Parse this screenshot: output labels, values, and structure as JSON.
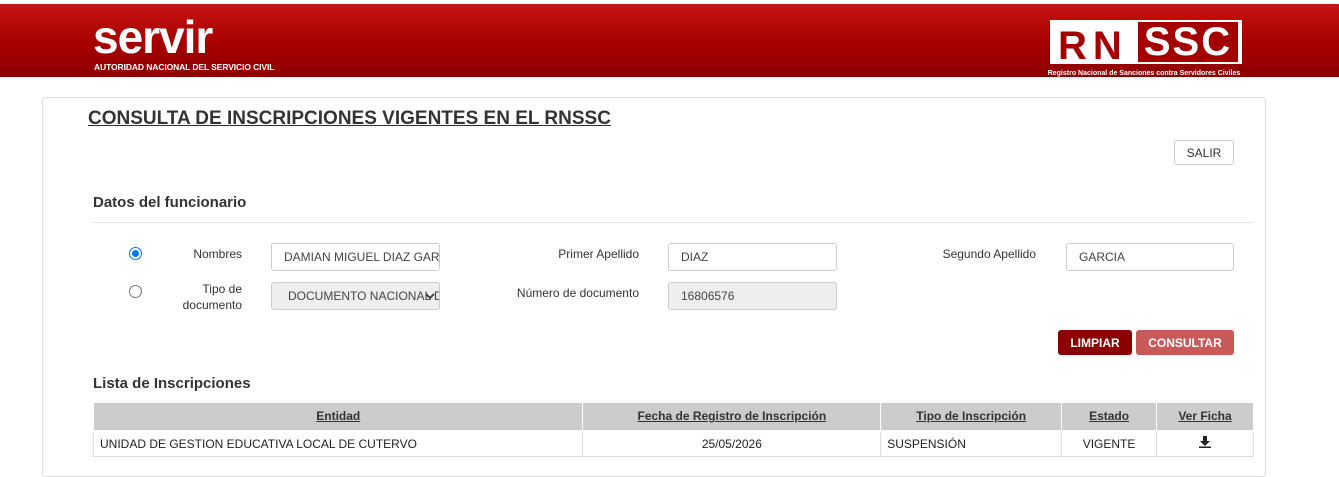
{
  "header": {
    "servir_logo_text": "servir",
    "servir_subtitle": "AUTORIDAD NACIONAL DEL SERVICIO CIVIL",
    "rnssc_logo_rn": "RN",
    "rnssc_logo_ssc": "SSC",
    "rnssc_subtitle": "Registro Nacional de Sanciones contra Servidores Civiles"
  },
  "page": {
    "title": "CONSULTA DE INSCRIPCIONES VIGENTES EN EL RNSSC",
    "exit_button": "SALIR"
  },
  "datos": {
    "section_title": "Datos del funcionario",
    "nombres_label": "Nombres",
    "nombres_value": "DAMIAN MIGUEL DIAZ GARCIA",
    "nombres_selected": true,
    "primer_apellido_label": "Primer Apellido",
    "primer_apellido_value": "DIAZ",
    "segundo_apellido_label": "Segundo Apellido",
    "segundo_apellido_value": "GARCIA",
    "tipo_documento_label_1": "Tipo de",
    "tipo_documento_label_2": "documento",
    "tipo_documento_value": "DOCUMENTO NACIONAL DE IDENTIDAD",
    "numero_documento_label": "Número de documento",
    "numero_documento_value": "16806576",
    "clear_button": "LIMPIAR",
    "search_button": "CONSULTAR"
  },
  "lista": {
    "section_title": "Lista de Inscripciones",
    "columns": [
      "Entidad",
      "Fecha de Registro de Inscripción",
      "Tipo de Inscripción",
      "Estado",
      "Ver Ficha"
    ],
    "rows": [
      {
        "entidad": "UNIDAD DE GESTION EDUCATIVA LOCAL DE CUTERVO",
        "fecha": "25/05/2026",
        "tipo": "SUSPENSIÓN",
        "estado": "VIGENTE",
        "ficha_icon": "download-icon"
      }
    ]
  },
  "colors": {
    "header_red": "#a50000",
    "button_dark_red": "#8b0000",
    "button_light_red": "#c95a5a",
    "radio_blue": "#0075ff"
  }
}
